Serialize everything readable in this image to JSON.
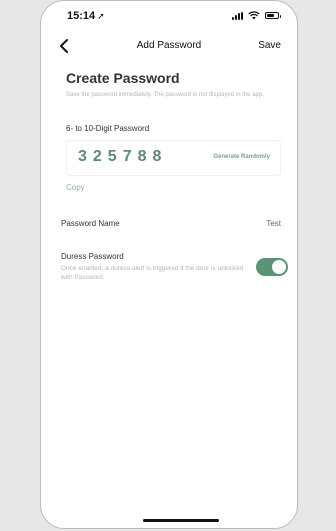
{
  "status_bar": {
    "time": "15:14",
    "location_icon": "location-arrow-icon",
    "icons": [
      "signal-icon",
      "wifi-icon",
      "battery-icon"
    ]
  },
  "nav": {
    "back_icon": "chevron-left-icon",
    "title": "Add Password",
    "save_label": "Save"
  },
  "create": {
    "heading": "Create Password",
    "hint": "Save the password immediately. The password is not displayed in the app.",
    "password_label": "6- to 10-Digit Password",
    "password_value": "325788",
    "generate_label": "Generate Randomly",
    "copy_label": "Copy"
  },
  "password_name": {
    "label": "Password Name",
    "value": "Test"
  },
  "duress": {
    "title": "Duress Password",
    "description": "Once enabled, a duress alert is triggered if the door is unlocked with Password.",
    "enabled": true
  },
  "colors": {
    "accent": "#5b9375",
    "password_digits": "#5c8a76",
    "hint_text": "#b6b6b6"
  }
}
